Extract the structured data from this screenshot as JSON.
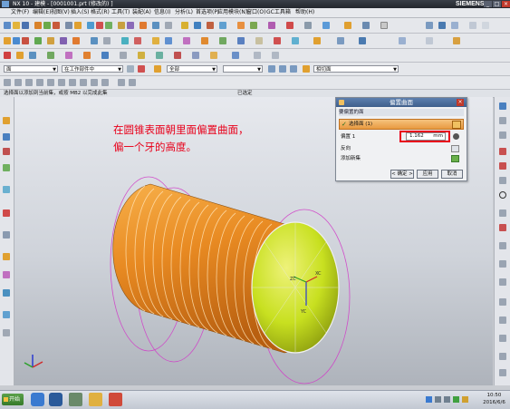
{
  "window": {
    "title": "NX 10 - 建模 - [0001001.prt (修改的) ]",
    "brand": "SIEMENS",
    "controls": [
      "_",
      "□",
      "×"
    ]
  },
  "menu": [
    "文件(F)",
    "编辑(E)",
    "视图(V)",
    "插入(S)",
    "格式(R)",
    "工具(T)",
    "装配(A)",
    "信息(I)",
    "分析(L)",
    "首选项(P)",
    "应用模块(N)",
    "窗口(O)",
    "GC工具箱",
    "帮助(H)"
  ],
  "selection_bar": {
    "filter_value": "面",
    "scope_value": "在工作部件中",
    "snap_value": "全部",
    "body_value": "相切面"
  },
  "status": {
    "prompt": "选择面以添加到当前集，或按 MB2 以完成此集",
    "selected": "已选定"
  },
  "annotation": {
    "line1": "在圆锥表面朝里面偏置曲面，",
    "line2": "偏一个牙的高度。"
  },
  "dialog": {
    "title": "偏置曲面",
    "section_header": "要偏置的面",
    "select_face_label": "选择面 (1)",
    "offset_label": "偏置 1",
    "offset_value": "1.162",
    "offset_unit": "mm",
    "reverse_label": "反向",
    "add_set_label": "添加新集",
    "ok_label": "< 确定 >",
    "apply_label": "应用",
    "cancel_label": "取消"
  },
  "axes": {
    "zc": "ZC",
    "yc": "YC",
    "xc": "XC"
  },
  "taskbar": {
    "start_label": "开始",
    "time": "10:50",
    "date": "2016/6/6"
  },
  "colors": {
    "cylinder": "#e88a22",
    "end_face": "#c8e020",
    "helix": "#d040c8",
    "annotation": "#e8001a",
    "highlight_box": "#e8001a"
  }
}
